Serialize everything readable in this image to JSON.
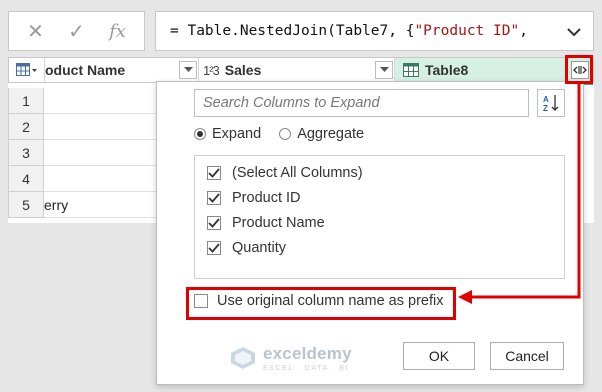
{
  "formula_bar": {
    "cancel_glyph": "✕",
    "commit_glyph": "✓",
    "fx_label": "fx",
    "formula_prefix": "= Table.NestedJoin(Table7, {",
    "formula_string": "\"Product ID\"",
    "formula_suffix": ","
  },
  "grid": {
    "columns": [
      {
        "label": "oduct Name",
        "type": "text"
      },
      {
        "label": "Sales",
        "type": "number",
        "type_glyph": "1²3"
      },
      {
        "label": "Table8",
        "type": "table"
      }
    ],
    "rows": [
      {
        "num": "1",
        "value": ""
      },
      {
        "num": "2",
        "value": ""
      },
      {
        "num": "3",
        "value": ""
      },
      {
        "num": "4",
        "value": ""
      },
      {
        "num": "5",
        "value": "erry"
      }
    ]
  },
  "expand_popup": {
    "search_placeholder": "Search Columns to Expand",
    "mode_options": [
      {
        "label": "Expand",
        "selected": true
      },
      {
        "label": "Aggregate",
        "selected": false
      }
    ],
    "columns": [
      {
        "label": "(Select All Columns)",
        "checked": true
      },
      {
        "label": "Product ID",
        "checked": true
      },
      {
        "label": "Product Name",
        "checked": true
      },
      {
        "label": "Quantity",
        "checked": true
      }
    ],
    "prefix_option": {
      "label": "Use original column name as prefix",
      "checked": false
    },
    "ok_label": "OK",
    "cancel_label": "Cancel"
  },
  "watermark": {
    "title": "exceldemy",
    "subtitle": "EXCEL · DATA · BI"
  },
  "colors": {
    "highlight": "#e00000",
    "table_header_accent": "#2bb494",
    "table_header_bg": "#d6f0e6"
  }
}
